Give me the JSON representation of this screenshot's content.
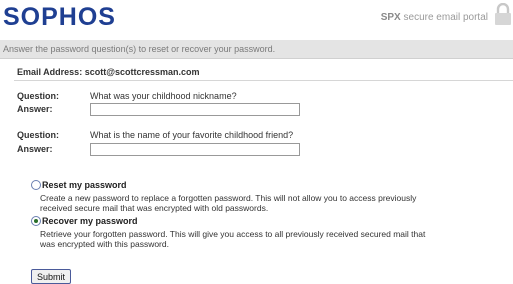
{
  "header": {
    "logo_text": "SOPHOS",
    "portal_prefix": "SPX",
    "portal_suffix": "secure email portal",
    "lock_icon": "padlock-icon"
  },
  "banner": {
    "text": "Answer the password question(s) to reset or recover your password."
  },
  "email": {
    "label": "Email Address:",
    "value": "scott@scottcressman.com"
  },
  "questions": [
    {
      "question_label": "Question:",
      "question_text": "What was your childhood nickname?",
      "answer_label": "Answer:",
      "answer_value": ""
    },
    {
      "question_label": "Question:",
      "question_text": "What is the name of your favorite childhood friend?",
      "answer_label": "Answer:",
      "answer_value": ""
    }
  ],
  "options": {
    "reset": {
      "title": "Reset my password",
      "description": "Create a new password to replace a forgotten password. This will not allow you to access previously received secure mail that was encrypted with old passwords.",
      "selected": false
    },
    "recover": {
      "title": "Recover my password",
      "description": "Retrieve your forgotten password. This will give you access to all previously received secured mail that was encrypted with this password.",
      "selected": true
    }
  },
  "submit_label": "Submit",
  "colors": {
    "brand": "#1f3f92",
    "banner_bg": "#e4e4e4"
  }
}
